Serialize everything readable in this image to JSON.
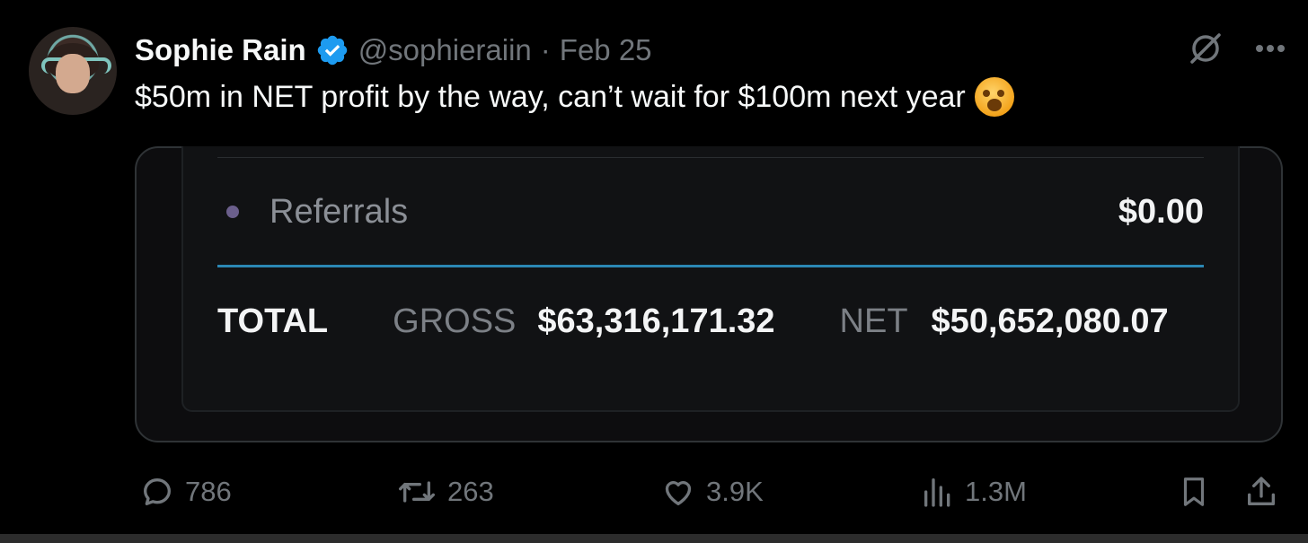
{
  "tweet": {
    "author_name": "Sophie Rain",
    "handle": "@sophieraiin",
    "separator": "·",
    "date": "Feb 25",
    "text": "$50m in NET profit by the way, can’t wait for $100m next year"
  },
  "card": {
    "referrals_label": "Referrals",
    "referrals_value": "$0.00",
    "total_label": "TOTAL",
    "gross_label": "GROSS",
    "gross_value": "$63,316,171.32",
    "net_label": "NET",
    "net_value": "$50,652,080.07"
  },
  "actions": {
    "replies": "786",
    "retweets": "263",
    "likes": "3.9K",
    "views": "1.3M"
  },
  "icons": [
    "verified-badge-icon",
    "grok-icon",
    "more-icon",
    "reply-icon",
    "retweet-icon",
    "like-icon",
    "views-icon",
    "bookmark-icon",
    "share-icon"
  ],
  "colors": {
    "background": "#000000",
    "text": "#e7e9ea",
    "muted": "#71767b",
    "verified": "#1d9bf0",
    "divider_accent": "#2b87b4"
  }
}
